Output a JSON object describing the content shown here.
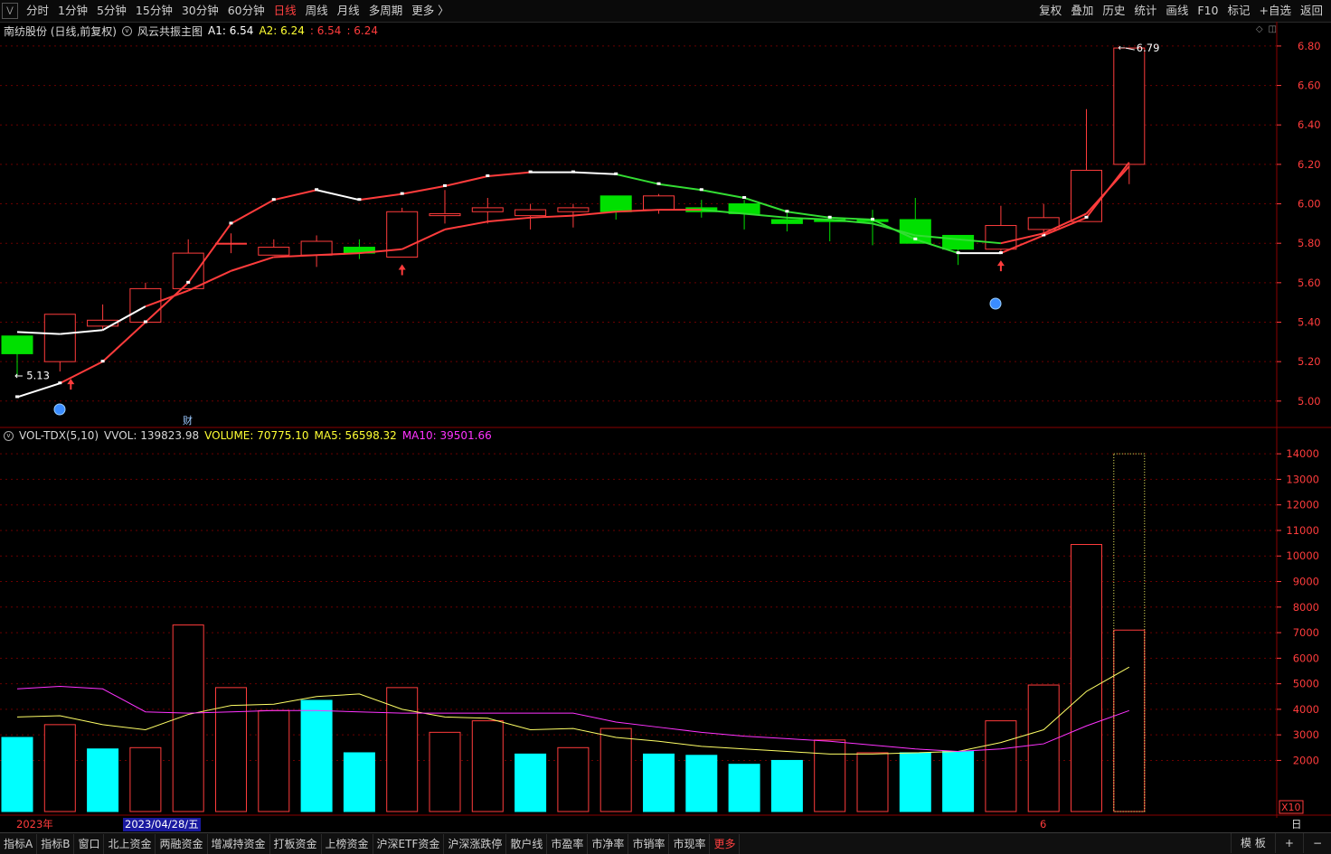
{
  "toolbar": {
    "periods": [
      "分时",
      "1分钟",
      "5分钟",
      "15分钟",
      "30分钟",
      "60分钟",
      "日线",
      "周线",
      "月线",
      "多周期",
      "更多 〉"
    ],
    "active_period": "日线",
    "actions": [
      "复权",
      "叠加",
      "历史",
      "统计",
      "画线",
      "F10",
      "标记",
      "+自选",
      "返回"
    ]
  },
  "main_info": {
    "stock": "南纺股份 (日线,前复权)",
    "indicator": "风云共振主图",
    "a1": "A1: 6.54",
    "a2": "A2: 6.24",
    "v3": ": 6.54",
    "v4": ": 6.24"
  },
  "vol_info": {
    "name": "VOL-TDX(5,10)",
    "vvol": "VVOL: 139823.98",
    "volume": "VOLUME: 70775.10",
    "ma5": "MA5: 56598.32",
    "ma10": "MA10: 39501.66"
  },
  "colors": {
    "up": "#ff3c3c",
    "down_candle": "#00e000",
    "down_vol": "#00ffff",
    "ma_white": "#ffffff",
    "ma5": "#ffff66",
    "ma10": "#ff33ff",
    "grid": "#6a0000",
    "axis_text": "#ff3c3c"
  },
  "annotations": {
    "low_label": "5.13",
    "high_label": "6.79",
    "fin_marker": "财",
    "vol_unit": "X10"
  },
  "dates": {
    "year": "2023年",
    "cursor": "2023/04/28/五",
    "month": "6",
    "period_label": "日线"
  },
  "bottom_tabs": [
    "指标A",
    "指标B",
    "窗口",
    "北上资金",
    "两融资金",
    "增减持资金",
    "打板资金",
    "上榜资金",
    "沪深ETF资金",
    "沪深涨跌停",
    "散户线",
    "市盈率",
    "市净率",
    "市销率",
    "市现率",
    "更多"
  ],
  "bottom_right": [
    "模 板",
    "+",
    "−"
  ],
  "chart_data": [
    {
      "type": "candlestick",
      "ylim": [
        4.88,
        6.85
      ],
      "yticks": [
        5.0,
        5.2,
        5.4,
        5.6,
        5.8,
        6.0,
        6.2,
        6.4,
        6.6,
        6.8
      ],
      "ohlc": [
        [
          5.33,
          5.33,
          5.13,
          5.24
        ],
        [
          5.2,
          5.44,
          5.15,
          5.44
        ],
        [
          5.38,
          5.49,
          5.36,
          5.41
        ],
        [
          5.4,
          5.6,
          5.4,
          5.57
        ],
        [
          5.57,
          5.82,
          5.57,
          5.75
        ],
        [
          5.8,
          5.85,
          5.75,
          5.8
        ],
        [
          5.74,
          5.82,
          5.74,
          5.78
        ],
        [
          5.74,
          5.84,
          5.68,
          5.81
        ],
        [
          5.78,
          5.82,
          5.72,
          5.75
        ],
        [
          5.73,
          5.98,
          5.73,
          5.96
        ],
        [
          5.94,
          6.07,
          5.9,
          5.95
        ],
        [
          5.96,
          6.03,
          5.9,
          5.98
        ],
        [
          5.94,
          6.0,
          5.87,
          5.97
        ],
        [
          5.96,
          6.0,
          5.88,
          5.98
        ],
        [
          6.04,
          6.04,
          5.92,
          5.96
        ],
        [
          5.97,
          6.05,
          5.95,
          6.04
        ],
        [
          5.98,
          6.02,
          5.93,
          5.96
        ],
        [
          6.0,
          6.02,
          5.87,
          5.95
        ],
        [
          5.92,
          5.96,
          5.86,
          5.9
        ],
        [
          5.92,
          5.94,
          5.81,
          5.91
        ],
        [
          5.92,
          5.97,
          5.79,
          5.91
        ],
        [
          5.92,
          6.03,
          5.82,
          5.8
        ],
        [
          5.84,
          5.84,
          5.69,
          5.77
        ],
        [
          5.77,
          5.99,
          5.75,
          5.89
        ],
        [
          5.87,
          6.0,
          5.84,
          5.93
        ],
        [
          5.91,
          6.48,
          5.91,
          6.17
        ],
        [
          6.2,
          6.79,
          6.1,
          6.79
        ]
      ],
      "ma_line": [
        5.02,
        5.09,
        5.2,
        5.4,
        5.6,
        5.9,
        6.02,
        6.07,
        6.02,
        6.05,
        6.09,
        6.14,
        6.16,
        6.16,
        6.15,
        6.1,
        6.07,
        6.03,
        5.96,
        5.93,
        5.92,
        5.82,
        5.75,
        5.75,
        5.84,
        5.93,
        6.21
      ],
      "ma_line_2": [
        5.35,
        5.34,
        5.36,
        5.48,
        5.56,
        5.66,
        5.73,
        5.74,
        5.75,
        5.77,
        5.87,
        5.91,
        5.93,
        5.94,
        5.96,
        5.97,
        5.97,
        5.95,
        5.93,
        5.92,
        5.9,
        5.84,
        5.82,
        5.8,
        5.85,
        5.95,
        6.19
      ],
      "up_arrows": [
        1,
        9,
        23
      ],
      "low_label": "5.13",
      "high_label": "6.79"
    },
    {
      "type": "bar",
      "title": "VOL-TDX(5,10)",
      "ylim": [
        0,
        14500
      ],
      "yticks": [
        2000,
        3000,
        4000,
        5000,
        6000,
        7000,
        8000,
        9000,
        10000,
        11000,
        12000,
        13000,
        14000
      ],
      "values": [
        2900,
        3400,
        2450,
        2500,
        7300,
        4850,
        3950,
        4350,
        2300,
        4850,
        3100,
        3550,
        2250,
        2500,
        3250,
        2250,
        2200,
        1850,
        2000,
        2800,
        2300,
        2300,
        2350,
        3550,
        4950,
        10450,
        7100
      ],
      "up": [
        false,
        true,
        false,
        true,
        true,
        true,
        true,
        false,
        false,
        true,
        true,
        true,
        false,
        true,
        true,
        false,
        false,
        false,
        false,
        true,
        true,
        false,
        false,
        true,
        true,
        true,
        true
      ],
      "vvol_last": 14000,
      "ma5": [
        3700,
        3750,
        3400,
        3200,
        3800,
        4150,
        4200,
        4500,
        4600,
        4000,
        3700,
        3650,
        3200,
        3250,
        2900,
        2750,
        2550,
        2450,
        2350,
        2250,
        2250,
        2300,
        2350,
        2700,
        3200,
        4700,
        5650
      ],
      "ma10": [
        4800,
        4900,
        4800,
        3900,
        3850,
        3900,
        3950,
        3950,
        3900,
        3850,
        3850,
        3850,
        3850,
        3850,
        3500,
        3300,
        3100,
        2950,
        2850,
        2750,
        2600,
        2450,
        2350,
        2450,
        2650,
        3350,
        3950
      ]
    }
  ]
}
